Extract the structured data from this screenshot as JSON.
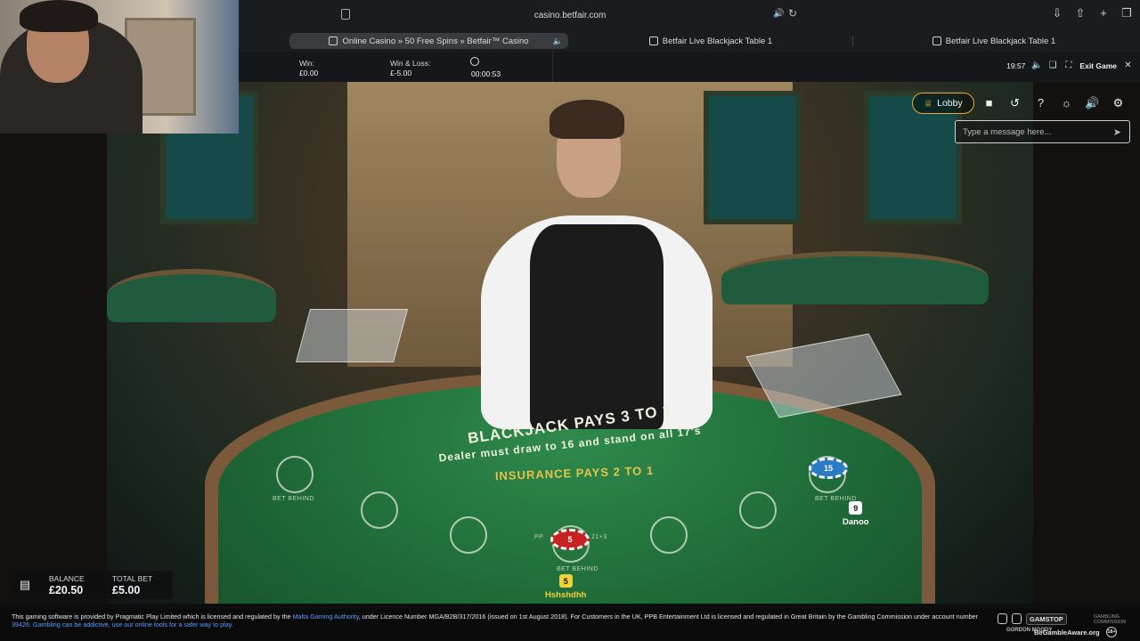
{
  "browser": {
    "url": "casino.betfair.com",
    "tabs": [
      {
        "label": "Online Casino » 50 Free Spins » Betfair™ Casino",
        "active": true
      },
      {
        "label": "Betfair Live Blackjack Table 1",
        "active": false
      },
      {
        "label": "Betfair Live Blackjack Table 1",
        "active": false
      }
    ],
    "action_icons": [
      "download-icon",
      "share-icon",
      "new-tab-icon",
      "tab-overview-icon"
    ]
  },
  "game_header": {
    "win_label": "Win:",
    "win_value": "£0.00",
    "winloss_label": "Win & Loss:",
    "winloss_value": "£-5.00",
    "timer_value": "00:00:53",
    "clock": "19:57",
    "exit_label": "Exit Game"
  },
  "video_controls": {
    "lobby_label": "Lobby",
    "tools": [
      "chat-icon",
      "history-icon",
      "help-icon",
      "support-icon",
      "sound-icon",
      "settings-icon"
    ],
    "chat_placeholder": "Type a message here..."
  },
  "table": {
    "title": "BLACKJACK PAYS 3 TO 2",
    "rule": "Dealer must draw to 16 and stand on all 17's",
    "insurance": "INSURANCE PAYS 2 TO 1",
    "spot_labels": [
      "BET BEHIND",
      "21+3",
      "PP"
    ],
    "chips": [
      {
        "value": "5",
        "color": "#c62222"
      },
      {
        "value": "15",
        "color": "#2a7bc4"
      }
    ],
    "players": [
      {
        "seat": "5",
        "name": "Hshshdhh",
        "color": "#f2d23a"
      },
      {
        "seat": "9",
        "name": "Danoo",
        "color": "#ffffff"
      }
    ]
  },
  "balances": {
    "balance_label": "BALANCE",
    "balance_value": "£20.50",
    "total_bet_label": "TOTAL BET",
    "total_bet_value": "£5.00"
  },
  "footer": {
    "legal_1": "This gaming software is provided by Pragmatic Play Limited which is licensed and regulated by the",
    "legal_link_1": "Malta Gaming Authority",
    "legal_2": ", under Licence Number MGA/B2B/317/2016 (issued on 1st August 2018). For Customers in the UK, PPB Entertainment Ltd is licensed and regulated in Great Britain by the Gambling Commission under account number",
    "legal_link_2": "39426. Gambling can be addictive, use our online tools for a safer way to play.",
    "gamstop": "GAMSTOP",
    "gambling_commission": "GAMBLING COMMISSION",
    "gordon_moody": "GORDON MOODY",
    "begambleaware": "BeGambleAware.org",
    "age": "18+"
  },
  "colors": {
    "accent": "#e8a92a",
    "felt": "#1f6b38",
    "link": "#5a9cff"
  }
}
